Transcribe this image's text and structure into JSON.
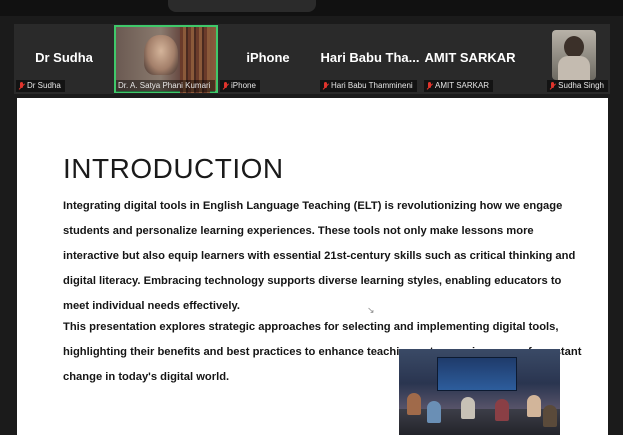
{
  "participants": [
    {
      "big_name": "Dr Sudha",
      "label": "Dr Sudha"
    },
    {
      "big_name": "",
      "label": "Dr. A. Satya Phani Kumari"
    },
    {
      "big_name": "iPhone",
      "label": "iPhone"
    },
    {
      "big_name": "Hari Babu Tha...",
      "label": "Hari Babu Thammineni"
    },
    {
      "big_name": "AMIT SARKAR",
      "label": "AMIT SARKAR"
    },
    {
      "big_name": "",
      "label": "Sudha Singh"
    }
  ],
  "slide": {
    "title": "INTRODUCTION",
    "paragraph_1": "Integrating digital tools in English Language Teaching (ELT) is revolutionizing how we engage students and personalize learning experiences. These tools not only make lessons more interactive but also equip learners with essential 21st-century skills such as critical thinking and digital literacy. Embracing technology supports diverse learning styles, enabling educators to meet individual needs effectively.",
    "paragraph_2": "This presentation explores strategic approaches for selecting and implementing digital tools, highlighting their benefits and best practices to enhance teaching outcomes in an era of constant change in today's digital world."
  },
  "colors": {
    "active_speaker": "#3fc86a",
    "muted_mic": "#e0342c",
    "meeting_background": "#1b1b1b",
    "slide_background": "#ffffff"
  },
  "icons": {
    "muted": "mic-muted-icon",
    "cursor": "mouse-cursor-icon"
  }
}
